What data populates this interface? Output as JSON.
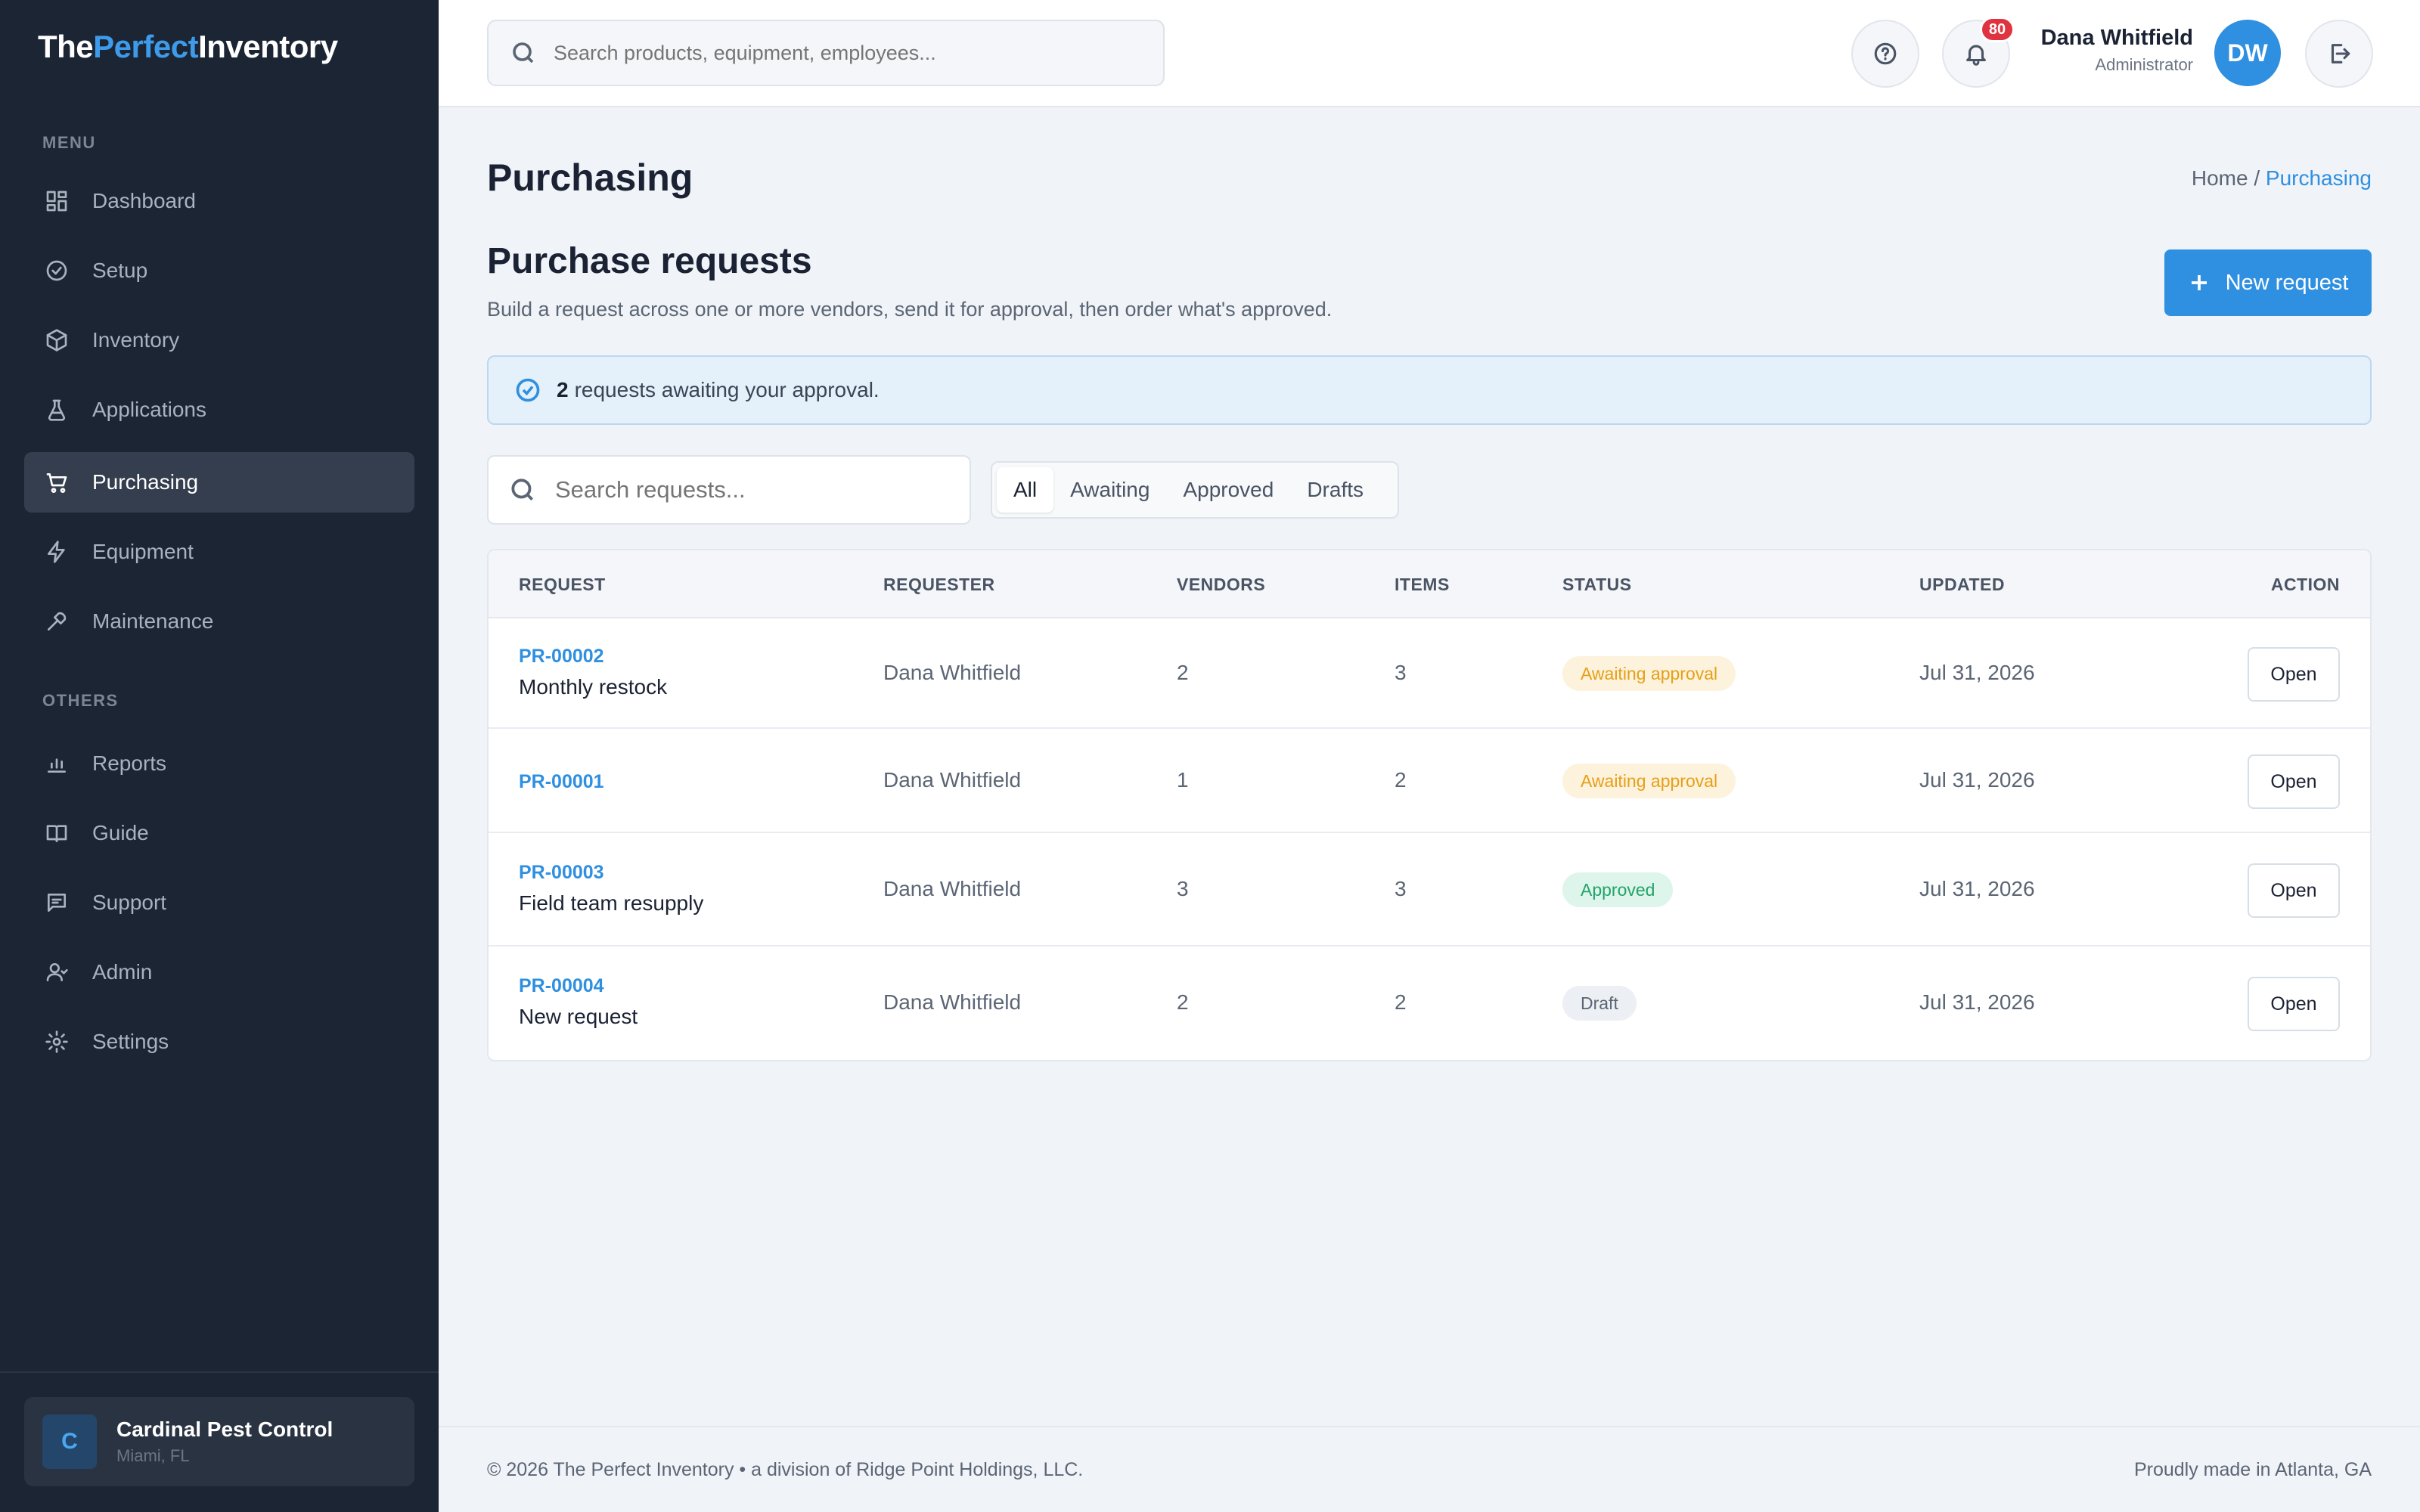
{
  "brand": {
    "part1": "The",
    "part2": "Perfect",
    "part3": "Inventory"
  },
  "sidebar": {
    "menu_label": "MENU",
    "others_label": "OTHERS",
    "menu_items": [
      {
        "label": "Dashboard",
        "icon": "dashboard-icon"
      },
      {
        "label": "Setup",
        "icon": "check-circle-icon"
      },
      {
        "label": "Inventory",
        "icon": "box-icon"
      },
      {
        "label": "Applications",
        "icon": "flask-icon"
      },
      {
        "label": "Purchasing",
        "icon": "cart-icon",
        "active": true
      },
      {
        "label": "Equipment",
        "icon": "bolt-icon"
      },
      {
        "label": "Maintenance",
        "icon": "wrench-icon"
      }
    ],
    "other_items": [
      {
        "label": "Reports",
        "icon": "bar-chart-icon"
      },
      {
        "label": "Guide",
        "icon": "book-icon"
      },
      {
        "label": "Support",
        "icon": "chat-icon"
      },
      {
        "label": "Admin",
        "icon": "users-icon"
      },
      {
        "label": "Settings",
        "icon": "gear-icon"
      }
    ],
    "org": {
      "initial": "C",
      "name": "Cardinal Pest Control",
      "location": "Miami, FL"
    }
  },
  "topbar": {
    "search_placeholder": "Search products, equipment, employees...",
    "notification_count": "80",
    "user_name": "Dana Whitfield",
    "user_role": "Administrator",
    "avatar_initials": "DW"
  },
  "page": {
    "title": "Purchasing",
    "breadcrumb_home": "Home",
    "breadcrumb_sep": "/",
    "breadcrumb_current": "Purchasing",
    "section_title": "Purchase requests",
    "section_subtitle": "Build a request across one or more vendors, send it for approval, then order what's approved.",
    "new_button": "New request",
    "alert_count": "2",
    "alert_text": "requests awaiting your approval.",
    "requests_search_placeholder": "Search requests...",
    "filter_tabs": [
      "All",
      "Awaiting",
      "Approved",
      "Drafts"
    ],
    "active_filter": "All"
  },
  "table": {
    "headers": [
      "REQUEST",
      "REQUESTER",
      "VENDORS",
      "ITEMS",
      "STATUS",
      "UPDATED",
      "ACTION"
    ],
    "rows": [
      {
        "id": "PR-00002",
        "name": "Monthly restock",
        "requester": "Dana Whitfield",
        "vendors": "2",
        "items": "3",
        "status": "Awaiting approval",
        "status_type": "awaiting",
        "updated": "Jul 31, 2026",
        "action": "Open"
      },
      {
        "id": "PR-00001",
        "name": "",
        "requester": "Dana Whitfield",
        "vendors": "1",
        "items": "2",
        "status": "Awaiting approval",
        "status_type": "awaiting",
        "updated": "Jul 31, 2026",
        "action": "Open"
      },
      {
        "id": "PR-00003",
        "name": "Field team resupply",
        "requester": "Dana Whitfield",
        "vendors": "3",
        "items": "3",
        "status": "Approved",
        "status_type": "approved",
        "updated": "Jul 31, 2026",
        "action": "Open"
      },
      {
        "id": "PR-00004",
        "name": "New request",
        "requester": "Dana Whitfield",
        "vendors": "2",
        "items": "2",
        "status": "Draft",
        "status_type": "draft",
        "updated": "Jul 31, 2026",
        "action": "Open"
      }
    ]
  },
  "footer": {
    "left": "© 2026 The Perfect Inventory • a division of Ridge Point Holdings, LLC.",
    "right": "Proudly made in Atlanta, GA"
  },
  "colors": {
    "accent": "#2f8fe0",
    "sidebar_bg": "#1c2533",
    "awaiting": "#e6a018",
    "approved": "#26a36a",
    "danger": "#e03340"
  }
}
